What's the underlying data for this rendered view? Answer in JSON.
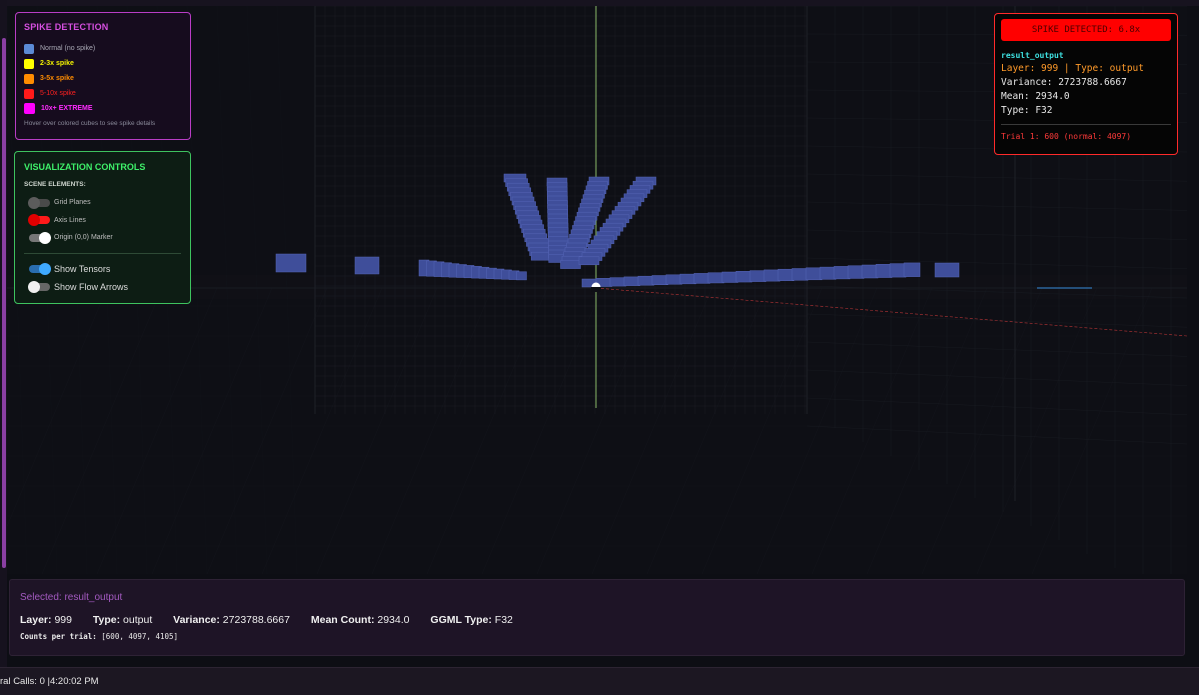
{
  "spike_legend": {
    "title": "SPIKE DETECTION",
    "items": [
      {
        "label": "Normal (no spike)",
        "color": "#5b8bd6",
        "text_color": "#a9a9b5"
      },
      {
        "label": "2-3x spike",
        "color": "#ffff00",
        "text_color": "#f2f200"
      },
      {
        "label": "3-5x spike",
        "color": "#ff8c00",
        "text_color": "#ff8c00"
      },
      {
        "label": "5-10x spike",
        "color": "#ff1a1a",
        "text_color": "#ff2020"
      },
      {
        "label": "10x+ EXTREME",
        "color": "#ff00ff",
        "text_color": "#ff2bff"
      }
    ],
    "hint": "Hover over colored cubes to see spike details"
  },
  "controls": {
    "title": "VISUALIZATION CONTROLS",
    "section_label": "SCENE ELEMENTS:",
    "toggles": [
      {
        "label": "Grid Planes",
        "on": false,
        "track": "#4a4a4a",
        "knob": "#5c5c5c"
      },
      {
        "label": "Axis Lines",
        "on": false,
        "track": "#ff1a1a",
        "knob": "#e00000"
      },
      {
        "label": "Origin (0,0) Marker",
        "on": true,
        "track": "#777777",
        "knob": "#ffffff"
      }
    ],
    "main_toggles": [
      {
        "label": "Show Tensors",
        "on": true,
        "track": "#2a6db0",
        "knob": "#3fa9ff"
      },
      {
        "label": "Show Flow Arrows",
        "on": false,
        "track": "#666666",
        "knob": "#f0f0f0"
      }
    ]
  },
  "detection": {
    "banner": "SPIKE DETECTED: 6.8x",
    "tensor_name": "result_output",
    "layer_type_line": "Layer: 999 | Type: output",
    "variance_line": "Variance: 2723788.6667",
    "mean_line": "Mean: 2934.0",
    "type_line": "Type: F32",
    "trial_line": "Trial 1: 600 (normal: 4097)"
  },
  "selection": {
    "selected_label": "Selected: result_output",
    "layer_label": "Layer:",
    "layer": "999",
    "type_label": "Type:",
    "type": "output",
    "variance_label": "Variance:",
    "variance": "2723788.6667",
    "mean_label": "Mean Count:",
    "mean": "2934.0",
    "ggml_label": "GGML Type:",
    "ggml": "F32",
    "counts_label": "Counts per trial:",
    "counts": "[600, 4097, 4105]"
  },
  "status": {
    "text": "ral Calls: 0 |4:20:02 PM"
  },
  "colors": {
    "tensor": "#3f4e9a",
    "tensor_top": "#5564b5",
    "grid": "#1e2128",
    "axis_y": "#a6e07a",
    "axis_x": "#ff4444"
  }
}
